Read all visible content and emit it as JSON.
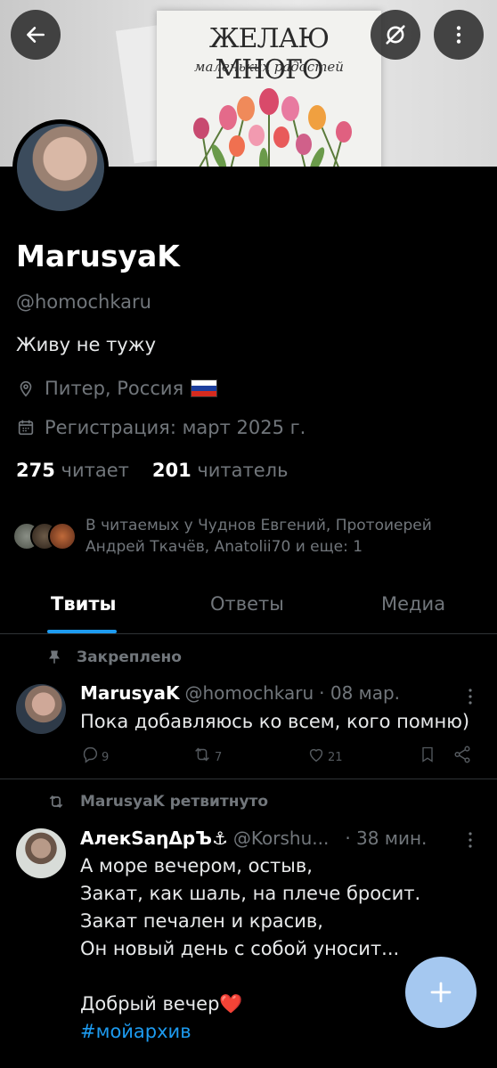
{
  "banner": {
    "card_title": "ЖЕЛАЮ МНОГО",
    "card_subtitle": "маленьких радостей"
  },
  "header": {
    "back_icon": "arrow-left-icon",
    "hide_icon": "eye-off-icon",
    "more_icon": "more-vertical-icon"
  },
  "profile": {
    "name": "MarusyaK",
    "handle": "@homochkaru",
    "bio": "Живу не тужу",
    "location": "Питер, Россия",
    "joined": "Регистрация: март 2025 г.",
    "following_count": "275",
    "following_label": "читает",
    "followers_count": "201",
    "followers_label": "читатель",
    "followed_by": "В читаемых у Чуднов Евгений, Протоиерей Андрей Ткачёв, Anatolii70 и еще: 1"
  },
  "tabs": [
    {
      "label": "Твиты",
      "active": true
    },
    {
      "label": "Ответы",
      "active": false
    },
    {
      "label": "Медиа",
      "active": false
    }
  ],
  "pinned_tweet": {
    "context": "Закреплено",
    "author": "MarusyaK",
    "handle": "@homochkaru",
    "time": "· 08 мар.",
    "text": "Пока добавляюсь ко всем, кого помню)",
    "replies": "9",
    "retweets": "7",
    "likes": "21"
  },
  "retweet": {
    "context": "MarusyaK ретвитнуто",
    "author": "АлекSаηΔрЪ⚓",
    "handle": "@Korshu...",
    "time": "· 38 мин.",
    "lines": [
      "А море вечером, остыв,",
      "Закат, как шаль, на плече бросит.",
      "Закат печален и красив,",
      "Он новый день с собой уносит...",
      "",
      "Добрый вечер❤️",
      "#мойархив"
    ]
  },
  "fab": {
    "icon": "plus-icon"
  },
  "colors": {
    "accent": "#1d9bf0",
    "background": "#000000",
    "muted": "#71767b",
    "fab": "#a5c8f0"
  }
}
